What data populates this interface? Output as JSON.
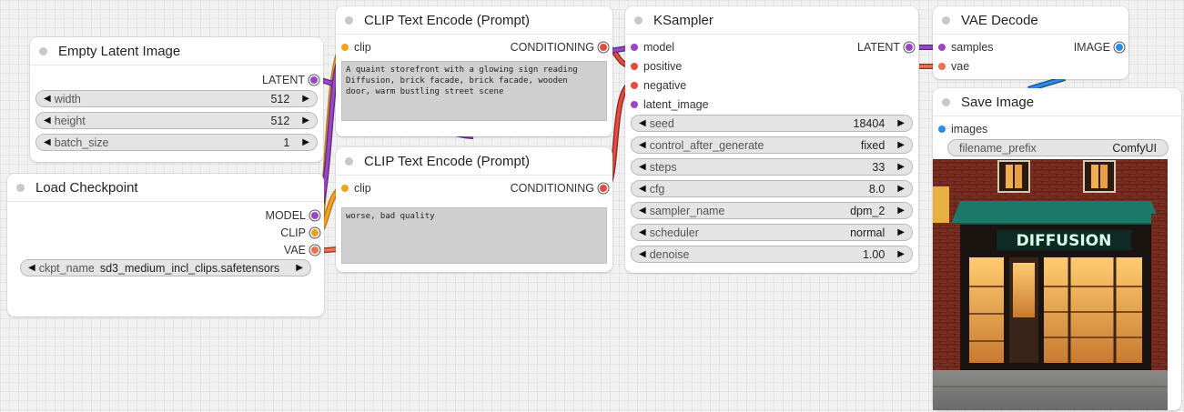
{
  "colors": {
    "clip": "#f5a020",
    "conditioning": "#e84a3a",
    "latent": "#9b46c7",
    "vae": "#f07050",
    "image": "#2c8ae8",
    "model": "#9b46c7"
  },
  "icons": {
    "decrement": "◀",
    "increment": "▶"
  },
  "empty_latent": {
    "title": "Empty Latent Image",
    "output_label": "LATENT",
    "widgets": [
      {
        "label": "width",
        "value": "512"
      },
      {
        "label": "height",
        "value": "512"
      },
      {
        "label": "batch_size",
        "value": "1"
      }
    ]
  },
  "load_checkpoint": {
    "title": "Load Checkpoint",
    "outputs": [
      "MODEL",
      "CLIP",
      "VAE"
    ],
    "widget": {
      "label": "ckpt_name",
      "value": "sd3_medium_incl_clips.safetensors"
    }
  },
  "clip_positive": {
    "title": "CLIP Text Encode (Prompt)",
    "input_label": "clip",
    "output_label": "CONDITIONING",
    "text": "A quaint storefront with a glowing sign reading\nDiffusion, brick facade, brick facade, wooden\ndoor, warm bustling street scene"
  },
  "clip_negative": {
    "title": "CLIP Text Encode (Prompt)",
    "input_label": "clip",
    "output_label": "CONDITIONING",
    "text": "worse, bad quality"
  },
  "ksampler": {
    "title": "KSampler",
    "inputs": [
      "model",
      "positive",
      "negative",
      "latent_image"
    ],
    "output_label": "LATENT",
    "widgets": [
      {
        "label": "seed",
        "value": "18404"
      },
      {
        "label": "control_after_generate",
        "value": "fixed"
      },
      {
        "label": "steps",
        "value": "33"
      },
      {
        "label": "cfg",
        "value": "8.0"
      },
      {
        "label": "sampler_name",
        "value": "dpm_2"
      },
      {
        "label": "scheduler",
        "value": "normal"
      },
      {
        "label": "denoise",
        "value": "1.00"
      }
    ]
  },
  "vae_decode": {
    "title": "VAE Decode",
    "inputs": [
      "samples",
      "vae"
    ],
    "output_label": "IMAGE"
  },
  "save_image": {
    "title": "Save Image",
    "input_label": "images",
    "widget": {
      "label": "filename_prefix",
      "value": "ComfyUI"
    },
    "image_sign": "DIFFUSION"
  }
}
